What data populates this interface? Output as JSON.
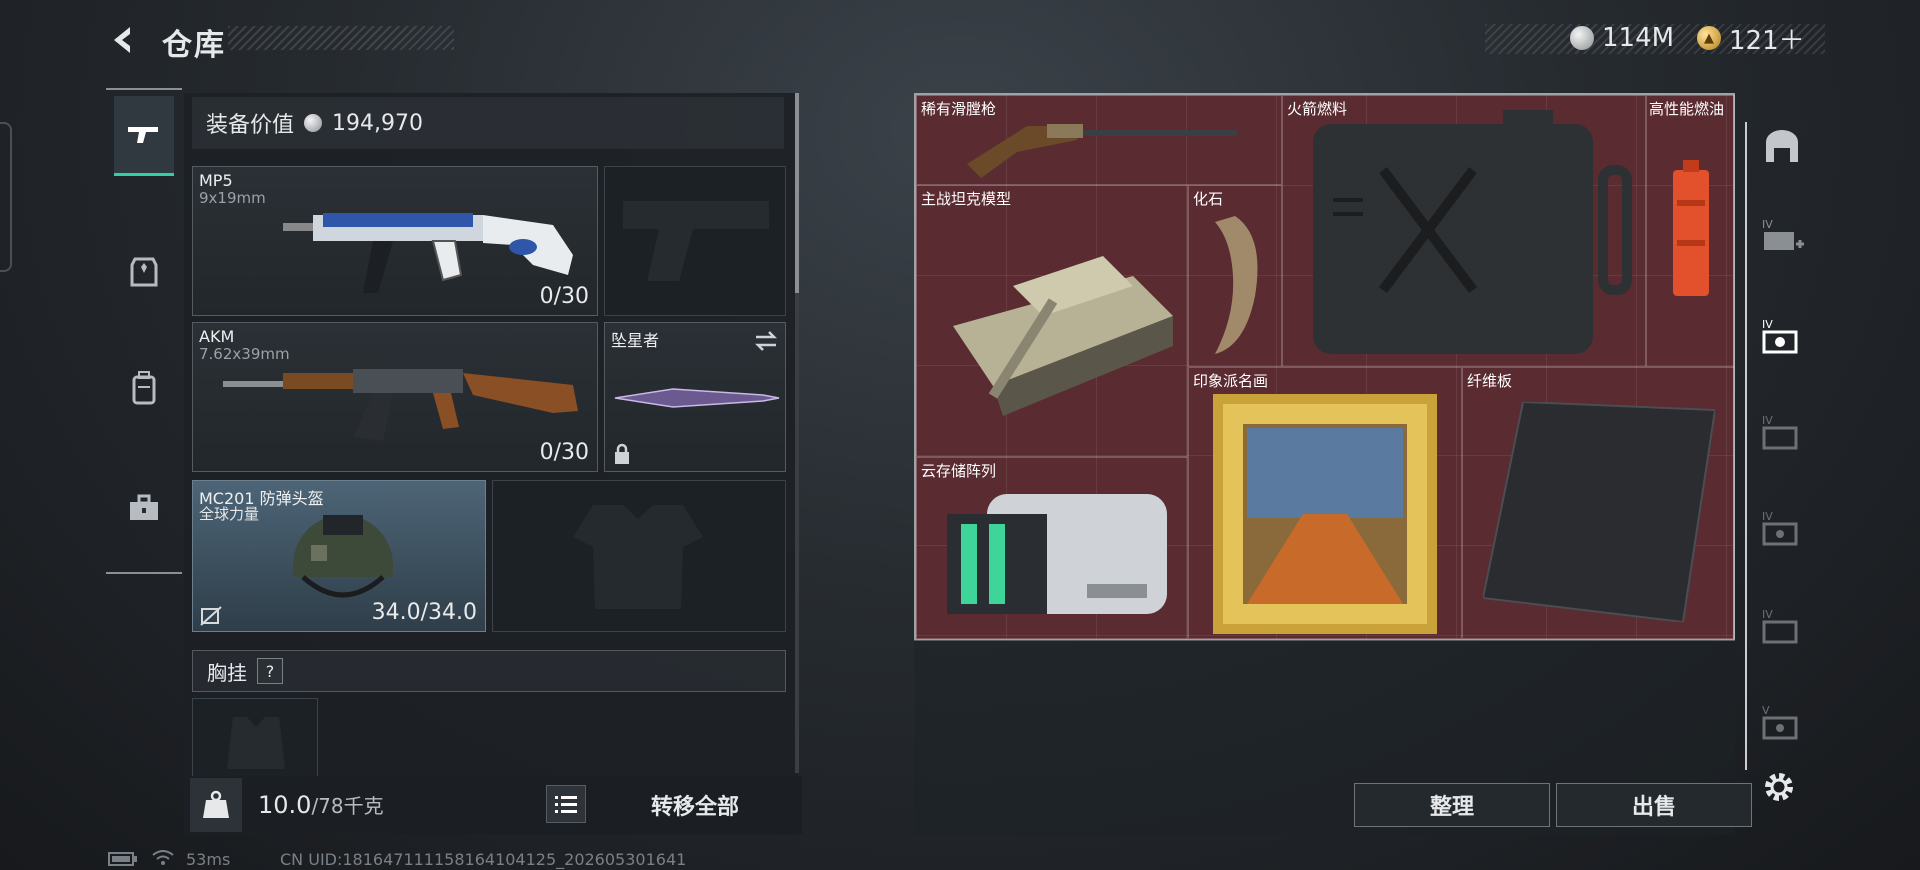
{
  "header": {
    "title": "仓库",
    "currency_silver": "114M",
    "currency_gold": "121＋"
  },
  "tabs": [
    "firearm-icon",
    "armor-icon",
    "backpack-icon",
    "toolbox-icon"
  ],
  "equipment": {
    "value_label": "装备价值",
    "value": "194,970",
    "primary": {
      "name": "MP5",
      "ammo_type": "9x19mm",
      "ammo": "0/30"
    },
    "secondary": {
      "name": "AKM",
      "ammo_type": "7.62x39mm",
      "ammo": "0/30"
    },
    "melee": {
      "name": "坠星者"
    },
    "helmet": {
      "name": "MC201 防弹头盔",
      "brand": "全球力量",
      "durability": "34.0/34.0"
    },
    "chest_rig_label": "胸挂",
    "help_mark": "?",
    "weight_current": "10.0",
    "weight_max": "/78千克",
    "weight_icon_text": "KG",
    "transfer_all": "转移全部"
  },
  "warehouse": {
    "items": [
      {
        "label": "稀有滑膛枪"
      },
      {
        "label": "火箭燃料"
      },
      {
        "label": "高性能燃油"
      },
      {
        "label": "主战坦克模型"
      },
      {
        "label": "化石"
      },
      {
        "label": "印象派名画"
      },
      {
        "label": "纤维板"
      },
      {
        "label": "云存储阵列"
      }
    ],
    "sort_button": "整理",
    "sell_button": "出售"
  },
  "status_bar": {
    "ping": "53ms",
    "uid": "CN UID:181647111158164104125_202605301641"
  },
  "colors": {
    "accent": "#2fd1a6",
    "grid_background": "#5a2b30"
  }
}
